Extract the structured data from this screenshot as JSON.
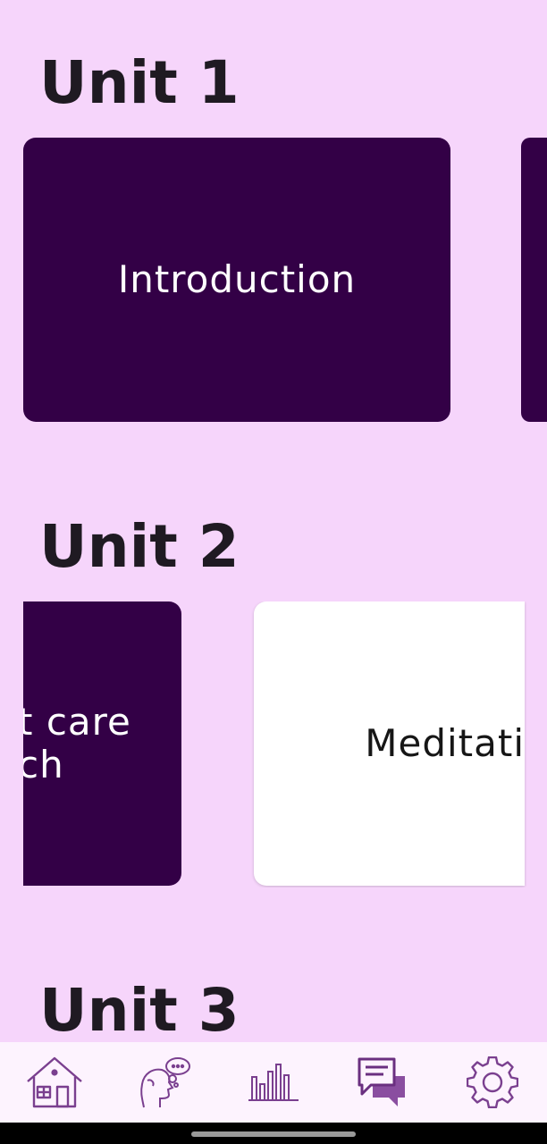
{
  "units": [
    {
      "title": "Unit 1",
      "cards": [
        {
          "label": "Introduction",
          "style": "dark"
        }
      ]
    },
    {
      "title": "Unit 2",
      "cards": [
        {
          "label_line1": "t care",
          "label_line2": "ch",
          "style": "dark"
        },
        {
          "label": "Meditati",
          "style": "light"
        }
      ]
    },
    {
      "title": "Unit 3"
    }
  ],
  "nav": {
    "items": [
      {
        "icon": "home-icon"
      },
      {
        "icon": "mind-icon"
      },
      {
        "icon": "stats-icon"
      },
      {
        "icon": "chat-icon"
      },
      {
        "icon": "settings-icon"
      }
    ]
  },
  "colors": {
    "background": "#f6d5fb",
    "card_dark": "#330046",
    "card_light": "#ffffff",
    "nav_background": "#fdf3fe",
    "icon": "#7a3f8f"
  }
}
